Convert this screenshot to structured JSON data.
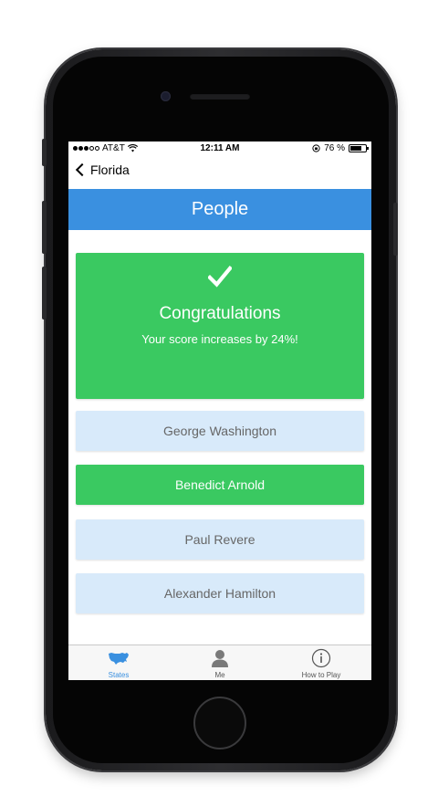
{
  "status_bar": {
    "carrier": "AT&T",
    "time": "12:11 AM",
    "battery": "76 %",
    "battery_level": 0.76
  },
  "nav": {
    "back_label": "Florida"
  },
  "header": {
    "title": "People"
  },
  "result": {
    "title": "Congratulations",
    "message": "Your score increases by 24%!",
    "icon": "checkmark-icon",
    "color": "#3ac961"
  },
  "answers": [
    {
      "label": "George Washington",
      "correct": false
    },
    {
      "label": "Benedict Arnold",
      "correct": true
    },
    {
      "label": "Paul Revere",
      "correct": false
    },
    {
      "label": "Alexander Hamilton",
      "correct": false
    }
  ],
  "tabs": [
    {
      "label": "States",
      "icon": "usa-map-icon",
      "active": true
    },
    {
      "label": "Me",
      "icon": "person-icon",
      "active": false
    },
    {
      "label": "How to Play",
      "icon": "info-icon",
      "active": false
    }
  ],
  "colors": {
    "accent": "#3a90e0",
    "success": "#3ac961",
    "answer_bg": "#d8eafa"
  }
}
